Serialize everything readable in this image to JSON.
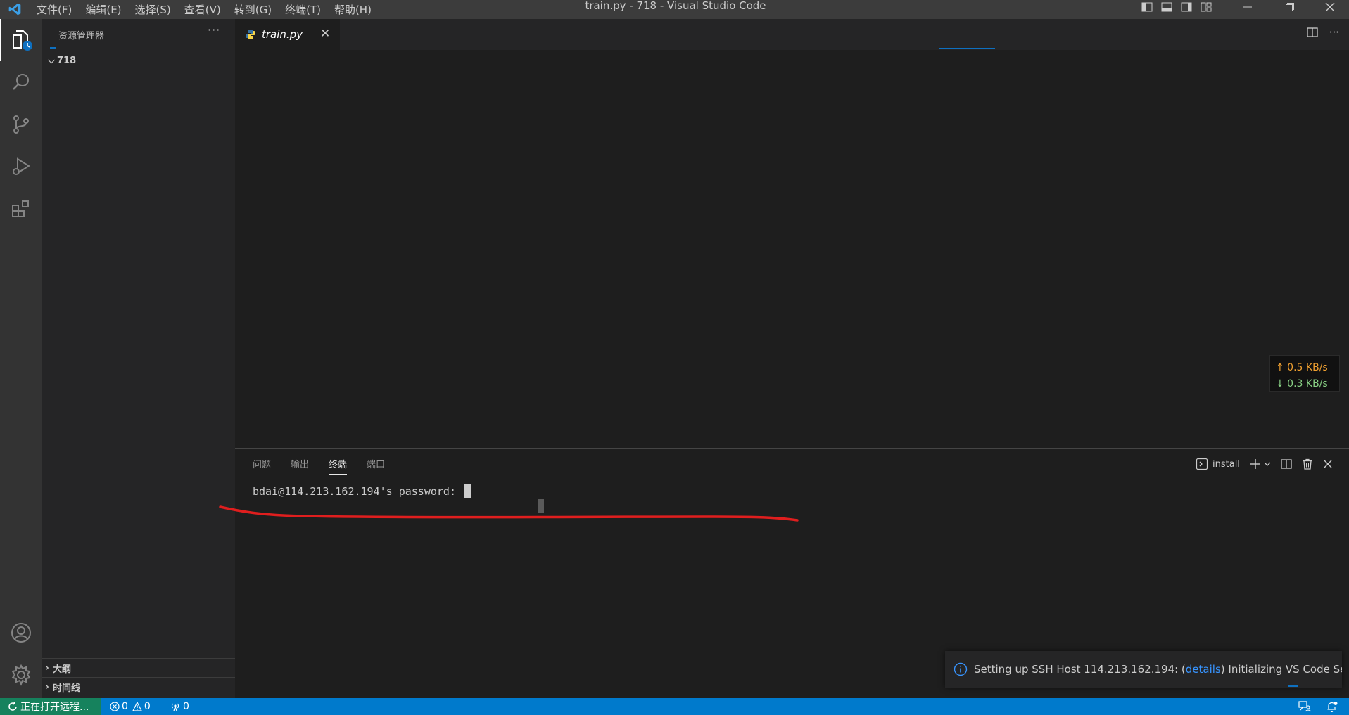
{
  "window": {
    "title": "train.py - 718 - Visual Studio Code",
    "menu": [
      "文件(F)",
      "编辑(E)",
      "选择(S)",
      "查看(V)",
      "转到(G)",
      "终端(T)",
      "帮助(H)"
    ]
  },
  "activity_bar": {
    "items": [
      "explorer-icon",
      "search-icon",
      "source-control-icon",
      "run-debug-icon",
      "extensions-icon"
    ],
    "bottom": [
      "account-icon",
      "settings-gear-icon"
    ]
  },
  "sidebar": {
    "title": "资源管理器",
    "folder": "718",
    "sections": [
      "大纲",
      "时间线"
    ]
  },
  "editor": {
    "tabs": [
      {
        "label": "train.py",
        "icon": "python-icon"
      }
    ]
  },
  "net_speed": {
    "upload": "↑ 0.5 KB/s",
    "download": "↓ 0.3 KB/s"
  },
  "panel": {
    "tabs": [
      "问题",
      "输出",
      "终端",
      "端口"
    ],
    "active_tab": "终端",
    "terminal_name": "install",
    "prompt": "bdai@114.213.162.194's password: "
  },
  "notification": {
    "text_before": "Setting up SSH Host 114.213.162.194: (",
    "link": "details",
    "text_after": ") Initializing VS Code Ser..."
  },
  "statusbar": {
    "remote": "正在打开远程...",
    "errors": "0",
    "warnings": "0",
    "ports": "0"
  },
  "colors": {
    "statusbar": "#007acc",
    "remote": "#16825d",
    "annotation": "#e01e1e"
  }
}
